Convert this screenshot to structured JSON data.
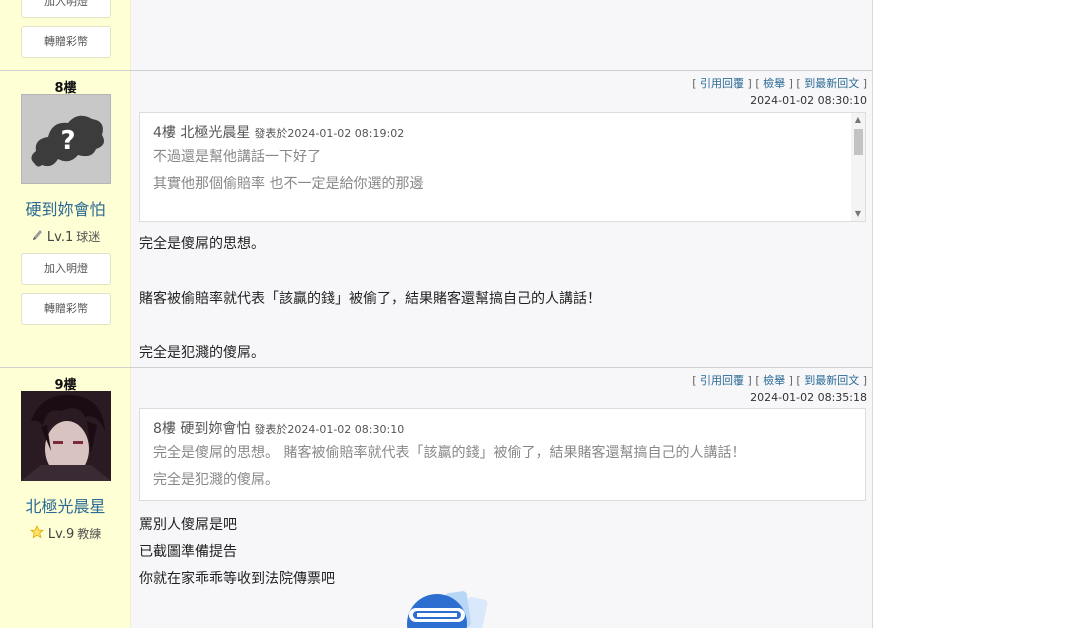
{
  "top_partial": {
    "buttons": [
      "加入明燈",
      "轉贈彩幣"
    ]
  },
  "posts": [
    {
      "floor": "8樓",
      "username": "硬到妳會怕",
      "level": "Lv.1",
      "rank": "球迷",
      "buttons": [
        "加入明燈",
        "轉贈彩幣"
      ],
      "links": {
        "quote": "引用回覆",
        "report": "檢舉",
        "latest": "到最新回文"
      },
      "time": "2024-01-02 08:30:10",
      "quote": {
        "floor": "4樓",
        "user": "北極光晨星",
        "posted": "發表於2024-01-02 08:19:02",
        "lines": [
          "不過還是幫他講話一下好了",
          "其實他那個偷賠率 也不一定是給你選的那邊"
        ]
      },
      "content": [
        "完全是傻屌的思想。",
        "賭客被偷賠率就代表「該贏的錢」被偷了，結果賭客還幫搞自己的人講話！",
        "完全是犯濺的傻屌。"
      ]
    },
    {
      "floor": "9樓",
      "username": "北極光晨星",
      "level": "Lv.9",
      "rank": "教練",
      "links": {
        "quote": "引用回覆",
        "report": "檢舉",
        "latest": "到最新回文"
      },
      "time": "2024-01-02 08:35:18",
      "quote": {
        "floor": "8樓",
        "user": "硬到妳會怕",
        "posted": "發表於2024-01-02 08:30:10",
        "lines": [
          "完全是傻屌的思想。 賭客被偷賠率就代表「該贏的錢」被偷了，結果賭客還幫搞自己的人講話！",
          "完全是犯濺的傻屌。"
        ]
      },
      "content": [
        "罵別人傻屌是吧",
        "已截圖準備提告",
        "你就在家乖乖等收到法院傳票吧"
      ]
    }
  ],
  "icons": {
    "default_avatar": "question-mark-cloud-icon",
    "level1": "pencil-icon",
    "level9": "star-icon",
    "sticker": "wanzhuan-cai-logo-icon"
  },
  "colors": {
    "sidebar": "#ffffd6",
    "username": "#2a6a94",
    "link": "#2a6a94",
    "star": "#f2c200"
  }
}
